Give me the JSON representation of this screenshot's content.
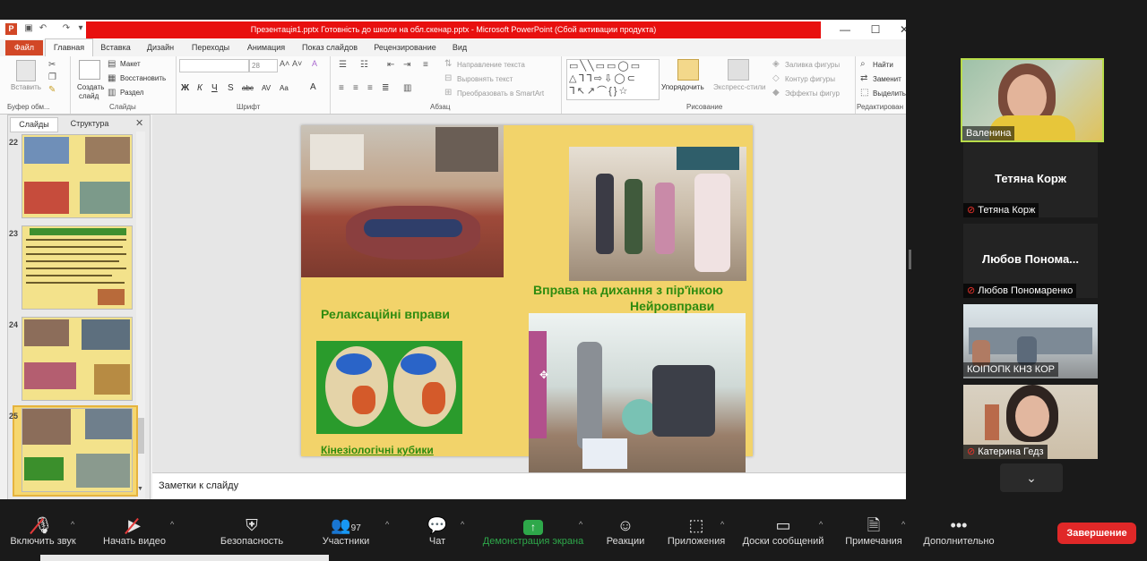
{
  "ppt": {
    "title": "Презентація1.pptx Готовність до школи на обл.скенар.pptx - Microsoft PowerPoint (Сбой активации продукта)",
    "tabs": [
      "Файл",
      "Главная",
      "Вставка",
      "Дизайн",
      "Переходы",
      "Анимация",
      "Показ слайдов",
      "Рецензирование",
      "Вид"
    ],
    "ribbon": {
      "clipboard": {
        "paste": "Вставить",
        "label": "Буфер обм..."
      },
      "slides": {
        "create": "Создать",
        "create2": "слайд",
        "layout": "Макет",
        "restore": "Восстановить",
        "section": "Раздел",
        "label": "Слайды"
      },
      "font": {
        "size": "28",
        "label": "Шрифт",
        "bold": "Ж",
        "italic": "К",
        "underline": "Ч",
        "strike": "S",
        "abc": "abc",
        "spacing": "AV",
        "case": "Aa",
        "color": "A"
      },
      "paragraph": {
        "dir": "Направление текста",
        "align": "Выровнять текст",
        "smartart": "Преобразовать в SmartArt",
        "label": "Абзац"
      },
      "drawing": {
        "arrange": "Упорядочить",
        "styles": "Экспресс-стили",
        "fill": "Заливка фигуры",
        "outline": "Контур фигуры",
        "effects": "Эффекты фигур",
        "label": "Рисование"
      },
      "editing": {
        "find": "Найти",
        "replace": "Заменит",
        "select": "Выделить",
        "label": "Редактирован"
      }
    },
    "panel_tabs": [
      "Слайды",
      "Структура"
    ],
    "thumb_numbers": [
      "22",
      "23",
      "24",
      "25"
    ],
    "notes": "Заметки к слайду",
    "slide": {
      "breath": "Вправа на дихання з пір'їнкою",
      "neuro": "Нейровправи",
      "relax": "Релаксаційні вправи",
      "cubes": "Кінезіологічні кубики"
    }
  },
  "participants": [
    {
      "name": "Валенина",
      "muted": false
    },
    {
      "name": "Тетяна Корж",
      "title": "Тетяна Корж",
      "muted": true
    },
    {
      "name": "Любов Пономаренко",
      "title": "Любов Понома...",
      "muted": true
    },
    {
      "name": "КОІПОПК КНЗ КОР",
      "muted": false
    },
    {
      "name": "Катерина Гедз",
      "muted": true
    }
  ],
  "toolbar": {
    "audio": "Включить звук",
    "video": "Начать видео",
    "security": "Безопасность",
    "participants": "Участники",
    "participants_count": "97",
    "chat": "Чат",
    "share": "Демонстрация экрана",
    "reactions": "Реакции",
    "apps": "Приложения",
    "boards": "Доски сообщений",
    "notes": "Примечания",
    "more": "Дополнительно",
    "end": "Завершение"
  },
  "colors": {
    "share_green": "#2ea84a",
    "end_red": "#e02828",
    "slide_bg": "#f2d36a",
    "title_red": "#e8100f"
  }
}
